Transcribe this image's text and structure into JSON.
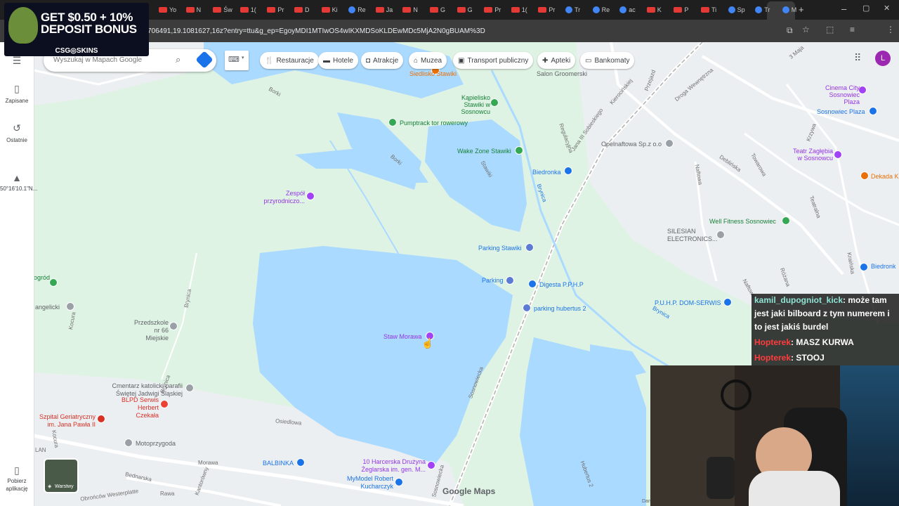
{
  "browser": {
    "url": "706491,19.1081627,16z?entry=ttu&g_ep=EgoyMDI1MTIwOS4wIKXMDSoKLDEwMDc5MjA2N0gBUAM%3D",
    "tabs": [
      "Yo",
      "N",
      "Św",
      "1(",
      "Pr",
      "D",
      "Ki",
      "Re",
      "Ja",
      "N",
      "G",
      "G",
      "Pr",
      "1(",
      "Pr",
      "Tr",
      "Re",
      "ac",
      "K",
      "P",
      "Ti",
      "Sp",
      "Tr",
      "M"
    ],
    "new_tab": "+",
    "window_controls": [
      "–",
      "▢",
      "✕"
    ]
  },
  "promo": {
    "title_line1": "GET $0.50 + 10%",
    "title_line2": "DEPOSIT BONUS",
    "brand": "CSG◎SKINS"
  },
  "sidebar": {
    "items": [
      {
        "label": "Zapisane"
      },
      {
        "label": "Ostatnie"
      },
      {
        "label": "50°16'10.1\"N..."
      },
      {
        "label": "Pobierz aplikację"
      }
    ]
  },
  "search": {
    "placeholder": "Wyszukaj w Mapach Google"
  },
  "chips": [
    "Restauracje",
    "Hotele",
    "Atrakcje",
    "Muzea",
    "Transport publiczny",
    "Apteki",
    "Bankomaty"
  ],
  "layers_label": "Warstwy",
  "map": {
    "brand": "Google Maps",
    "attribution": "Dan",
    "pois": [
      {
        "label": "Siedlisko Stawiki",
        "color": "orange"
      },
      {
        "label": "Salon Groomerski",
        "color": "gray"
      },
      {
        "label": "Kąpielisko Stawiki w Sosnowcu",
        "color": "green"
      },
      {
        "label": "Pumptrack tor rowerowy",
        "color": "green"
      },
      {
        "label": "Wake Zone Stawiki",
        "color": "green"
      },
      {
        "label": "Biedronka",
        "color": "blue"
      },
      {
        "label": "Opelnaftowa Sp.z o.o",
        "color": "gray"
      },
      {
        "label": "Cinema City Sosnowiec Plaza",
        "color": "purple"
      },
      {
        "label": "Sosnowiec Plaza",
        "color": "blue"
      },
      {
        "label": "Teatr Zagłębia w Sosnowcu",
        "color": "purple"
      },
      {
        "label": "Dekada K",
        "color": "orange"
      },
      {
        "label": "Zespół przyrodniczo...",
        "color": "purple"
      },
      {
        "label": "Parking Stawiki",
        "color": "blue"
      },
      {
        "label": "SILESIAN ELECTRONICS...",
        "color": "gray"
      },
      {
        "label": "Well Fitness Sosnowiec",
        "color": "green"
      },
      {
        "label": "Parking",
        "color": "blue"
      },
      {
        "label": "Digesta P.P.H.P",
        "color": "blue"
      },
      {
        "label": "parking hubertus 2",
        "color": "blue"
      },
      {
        "label": "P.U.H.P. DOM-SERWIS",
        "color": "blue"
      },
      {
        "label": "Biedronk",
        "color": "blue"
      },
      {
        "label": "Staw Morawa",
        "color": "purple"
      },
      {
        "label": "Przedszkole nr 66 Miejskie",
        "color": "gray"
      },
      {
        "label": "Cmentarz katolicki parafii Świętej Jadwigi Śląskiej",
        "color": "gray"
      },
      {
        "label": "BLPD Serwis Herbert Czekała",
        "color": "red"
      },
      {
        "label": "Szpital Geriatryczny im. Jana Pawła II",
        "color": "red"
      },
      {
        "label": "Motoprzygoda",
        "color": "gray"
      },
      {
        "label": "BALBINKA",
        "color": "blue"
      },
      {
        "label": "10 Harcerska Drużyna Żeglarska im. gen. M...",
        "color": "purple"
      },
      {
        "label": "MyModel Robert Kucharczyk",
        "color": "blue"
      },
      {
        "label": "angelicki",
        "color": "gray"
      },
      {
        "label": "ogród",
        "color": "green"
      }
    ],
    "roads": [
      "Borki",
      "Borki",
      "Stawiki",
      "Brynica",
      "Jana III Sobieskiego",
      "Regulacyjna",
      "Naftowa",
      "Deblińska",
      "Towarowa",
      "Teatralna",
      "Brynica",
      "Sosnowiecka",
      "Osiedlowa",
      "Morawa",
      "Bednarska",
      "Kantorówny",
      "Obrońców Westerplatte",
      "Rawa",
      "Hubertus 2",
      "Brynica",
      "Kocura",
      "3 Maja",
      "Przejazd",
      "Droga Wewnętrzna",
      "Kierocińskiej",
      "Krzywa",
      "Różana",
      "Naftowa",
      "Kraińska",
      "Kocura",
      "Brynica",
      "Sosnowiecka",
      "LAN"
    ]
  },
  "chat": {
    "messages": [
      {
        "user": "kamil_dupogniot_kick",
        "text": ": może tam jest jaki bilboard z tym numerem i to jest jakiś burdel",
        "user_color": "#8ee4d3"
      },
      {
        "user": "Hopterek",
        "text": ": MASZ KURWA",
        "user_color": "#ff3b3b"
      },
      {
        "user": "Hopterek",
        "text": ": STOOJ",
        "user_color": "#ff3b3b"
      }
    ]
  },
  "colors": {
    "water": "#aadaff",
    "park": "#dff3e4",
    "road": "#ffffff",
    "rail": "#b0b0b0",
    "chrome_dark": "#1f1f1f"
  }
}
